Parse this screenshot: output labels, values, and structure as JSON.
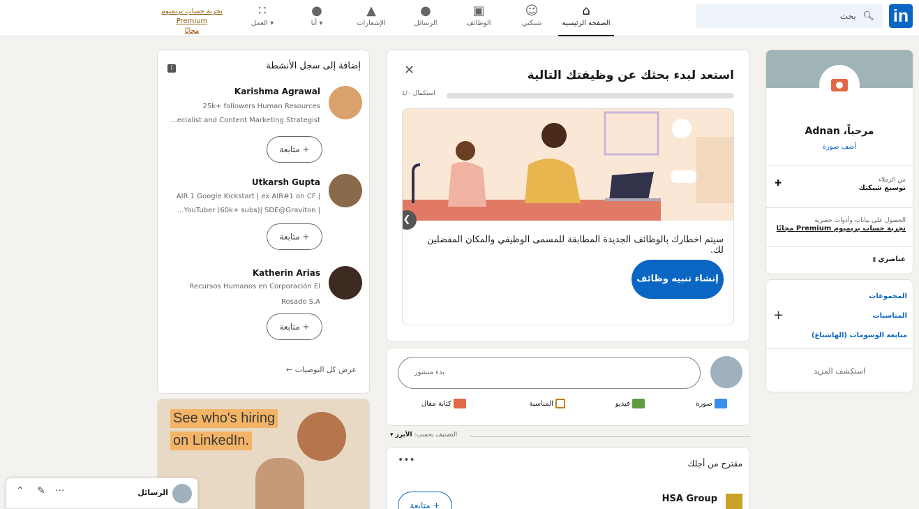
{
  "nav": {
    "search_placeholder": "بحث",
    "home": "الصفحة الرئيسية",
    "network": "شبكتي",
    "jobs": "الوظائف",
    "messaging": "الرسائل",
    "notifications": "الإشعارات",
    "me": "أنا ▾",
    "work": "العمل ▾",
    "premium_line1": "تجربة حساب بريميوم Premium",
    "premium_line2": "مجانًا"
  },
  "profile": {
    "greeting": "مرحباً، Adnan",
    "add_photo": "أضف صورة",
    "connections_label": "من الزملاء",
    "connections_action": "توسيع شبكتك",
    "premium_text": "الحصول على بيانات وأدوات حصرية",
    "premium_link": "تجربة حساب بريميوم Premium مجانًا",
    "saved": "عناصري"
  },
  "groups": {
    "groups": "المجموعات",
    "events": "المناسبات",
    "hashtags": "متابعة الوسومات (الهاشتاغ)",
    "discover": "استكشف المزيد"
  },
  "jobcard": {
    "title": "استعد لبدء بحثك عن وظيفتك التالية",
    "progress_label": "استكمال ٤/٠",
    "description": "سيتم اخطارك بالوظائف الجديدة المطابقة للمسمى الوظيفي والمكان المفضلين لك.",
    "cta": "إنشاء تنبيه وظائف"
  },
  "post": {
    "placeholder": "بدء منشور",
    "photo": "صورة",
    "video": "فيديو",
    "event": "المناسبة",
    "article": "كتابة مقال"
  },
  "sort": {
    "label": "التصنيف بحسب:",
    "value": "الأبرز ▾"
  },
  "suggested": {
    "title": "مقترح من أجلك",
    "company": "HSA Group",
    "follow": "+ متابعة"
  },
  "recs": {
    "title": "إضافة إلى سجل الأنشطة",
    "people": [
      {
        "name": "Karishma Agrawal",
        "desc1": "25k+ followers Human Resources",
        "desc2": "...ecialist and Content Marketing Strategist",
        "follow": "+ متابعة"
      },
      {
        "name": "Utkarsh Gupta",
        "desc1": "AIR 1 Google Kickstart | ex AIR#1 on CF |",
        "desc2": "...YouTuber (60k+ subs)| SDE@Graviton |",
        "follow": "+ متابعة"
      },
      {
        "name": "Katherin Arias",
        "desc1": "Recursos Humanos en Corporación El",
        "desc2": "Rosado S.A",
        "follow": "+ متابعة"
      }
    ],
    "view_all": "عرض كل التوصيات ←"
  },
  "ad": {
    "line1": "See who's hiring",
    "line2": "on LinkedIn."
  },
  "messaging": {
    "label": "الرسائل"
  }
}
